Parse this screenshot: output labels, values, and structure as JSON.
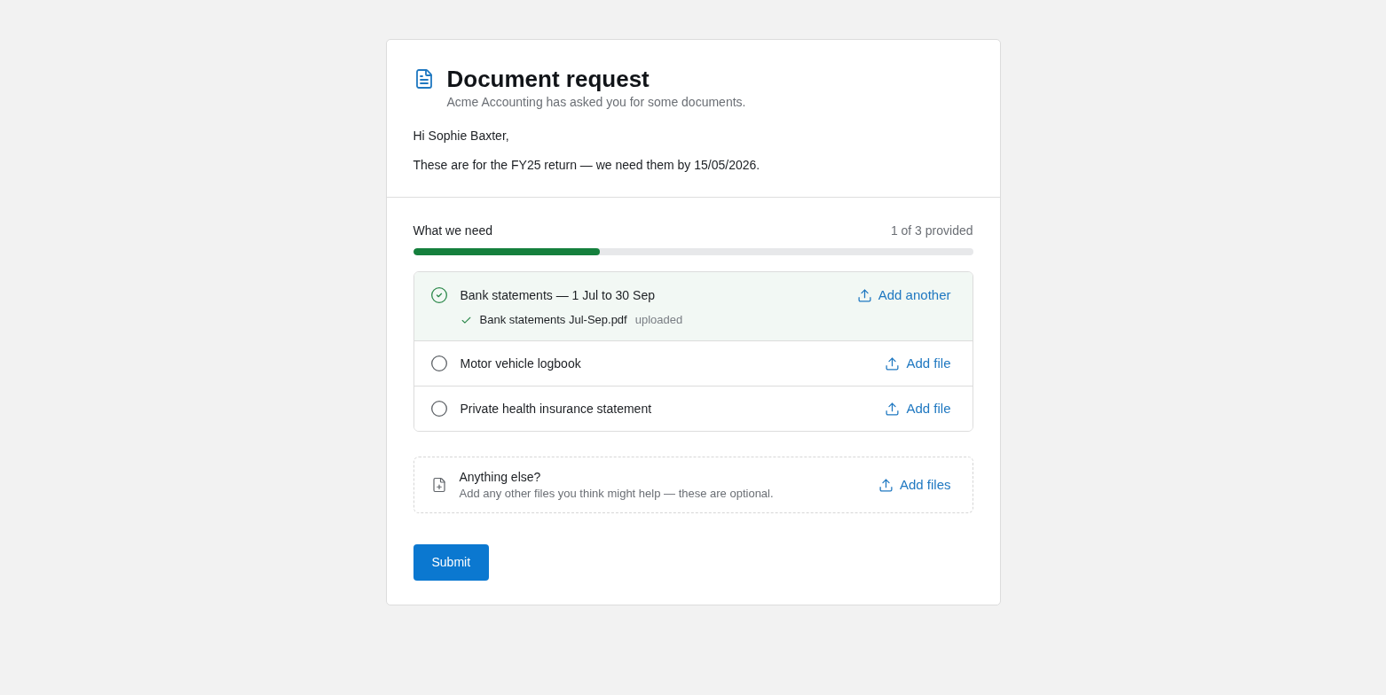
{
  "header": {
    "title": "Document request",
    "subtitle": "Acme Accounting has asked you for some documents."
  },
  "message": {
    "greeting": "Hi Sophie Baxter,",
    "body": "These are for the FY25 return — we need them by 15/05/2026."
  },
  "requirements": {
    "heading": "What we need",
    "progress": {
      "text": "1 of 3 provided",
      "level": 0.333
    },
    "items": [
      {
        "label": "Bank statements — 1 Jul to 30 Sep",
        "provided": true,
        "action": "Add another",
        "files": [
          {
            "name": "Bank statements Jul-Sep.pdf",
            "status": "uploaded"
          }
        ]
      },
      {
        "label": "Motor vehicle logbook",
        "provided": false,
        "action": "Add file"
      },
      {
        "label": "Private health insurance statement",
        "provided": false,
        "action": "Add file"
      }
    ]
  },
  "extras": {
    "title": "Anything else?",
    "description": "Add any other files you think might help — these are optional.",
    "action": "Add files"
  },
  "submit": {
    "label": "Submit"
  }
}
